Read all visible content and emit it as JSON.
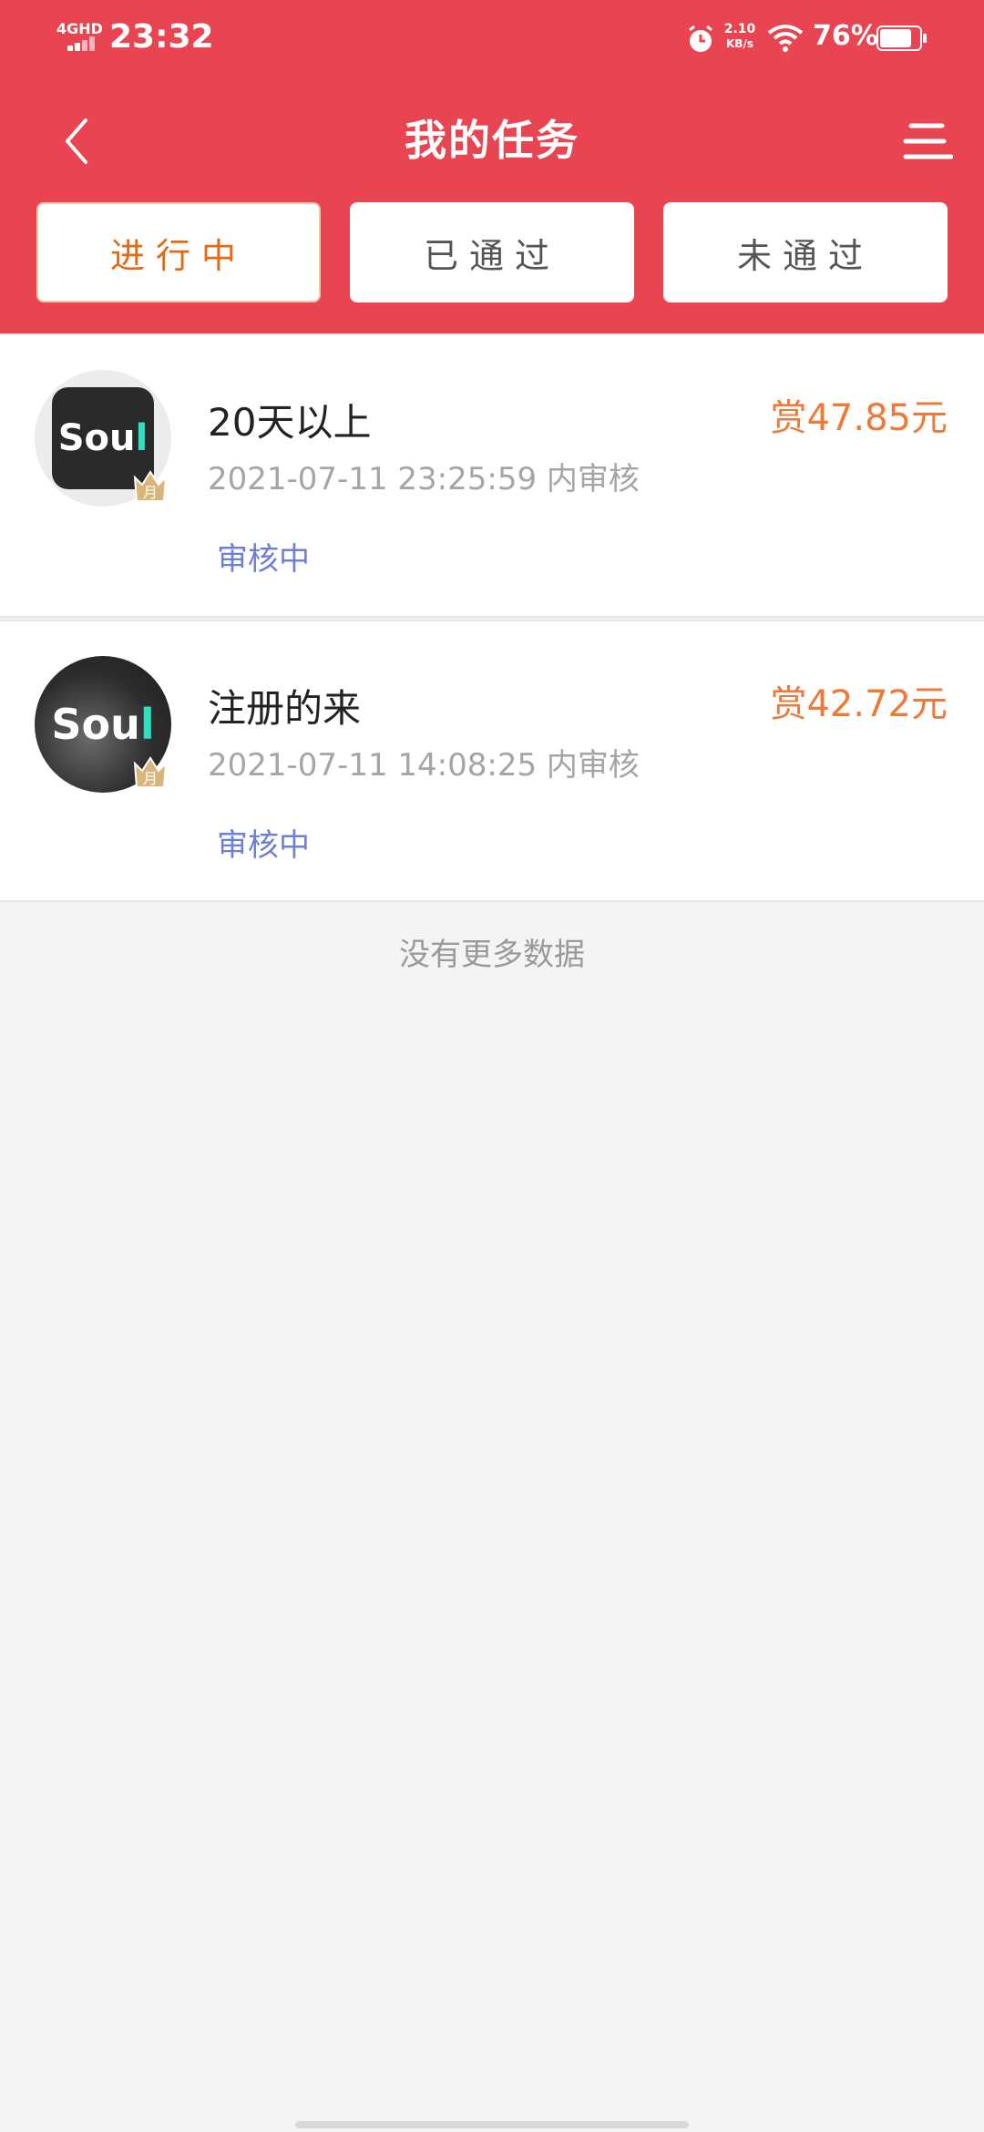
{
  "status_bar": {
    "network": "4GHD",
    "time": "23:32",
    "speed_value": "2.10",
    "speed_unit": "KB/s",
    "battery": "76%"
  },
  "header": {
    "title": "我的任务",
    "back_icon": "chevron-left-icon",
    "menu_icon": "menu-icon"
  },
  "tabs": [
    {
      "label": "进行中",
      "active": true
    },
    {
      "label": "已通过",
      "active": false
    },
    {
      "label": "未通过",
      "active": false
    }
  ],
  "tasks": [
    {
      "title": "20天以上",
      "reward": "赏47.85元",
      "time": "2021-07-11 23:25:59 内审核",
      "status": "审核中",
      "logo_prefix": "Sou",
      "logo_accent": "l",
      "badge": "月"
    },
    {
      "title": "注册的来",
      "reward": "赏42.72元",
      "time": "2021-07-11 14:08:25 内审核",
      "status": "审核中",
      "logo_prefix": "Sou",
      "logo_accent": "l",
      "badge": "月"
    }
  ],
  "footer_text": "没有更多数据",
  "colors": {
    "header_bg": "#e84451",
    "active_tab_text": "#e26a14",
    "reward": "#ee7a3a",
    "status": "#6d7fd6"
  }
}
